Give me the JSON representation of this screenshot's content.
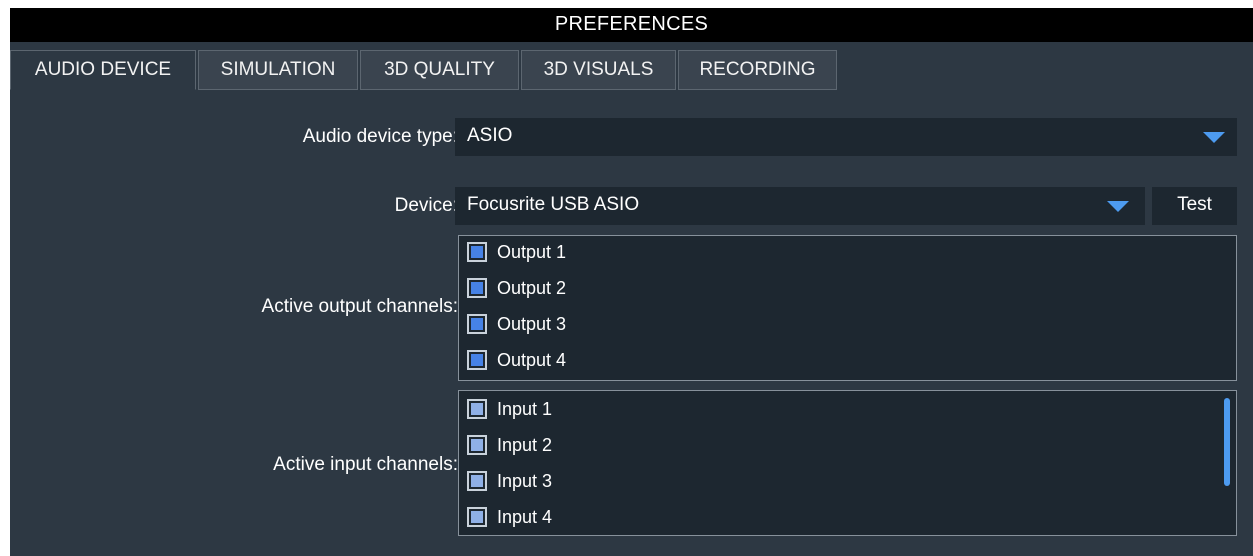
{
  "window": {
    "title": "PREFERENCES"
  },
  "tabs": [
    {
      "label": "AUDIO DEVICE",
      "active": true
    },
    {
      "label": "SIMULATION",
      "active": false
    },
    {
      "label": "3D QUALITY",
      "active": false
    },
    {
      "label": "3D VISUALS",
      "active": false
    },
    {
      "label": "RECORDING",
      "active": false
    }
  ],
  "audio_device_type": {
    "label": "Audio device type:",
    "value": "ASIO"
  },
  "device": {
    "label": "Device:",
    "value": "Focusrite USB ASIO",
    "test_label": "Test"
  },
  "output_channels": {
    "label": "Active output channels:",
    "items": [
      {
        "label": "Output 1",
        "checked": true
      },
      {
        "label": "Output 2",
        "checked": true
      },
      {
        "label": "Output 3",
        "checked": true
      },
      {
        "label": "Output 4",
        "checked": true
      }
    ]
  },
  "input_channels": {
    "label": "Active input channels:",
    "items": [
      {
        "label": "Input 1",
        "checked": true
      },
      {
        "label": "Input 2",
        "checked": true
      },
      {
        "label": "Input 3",
        "checked": true
      },
      {
        "label": "Input 4",
        "checked": true
      }
    ]
  },
  "colors": {
    "background": "#2d3843",
    "field": "#1d2730",
    "accent": "#4d9bf0",
    "checkbox_on": "#4682e6",
    "checkbox_input": "#8fb0e6"
  },
  "icons": {
    "dropdown": "chevron-down-icon",
    "checkbox": "checkbox-checked-icon"
  }
}
